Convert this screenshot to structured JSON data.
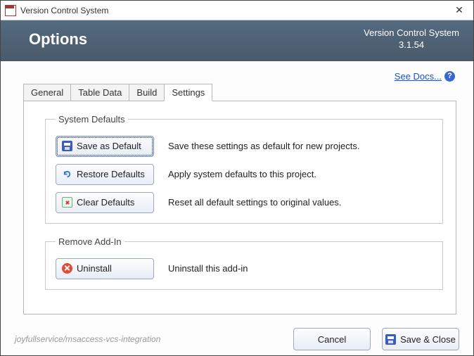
{
  "window": {
    "title": "Version Control System"
  },
  "header": {
    "title": "Options",
    "product": "Version Control System",
    "version": "3.1.54"
  },
  "links": {
    "see_docs": "See Docs..."
  },
  "tabs": {
    "general": "General",
    "table_data": "Table Data",
    "build": "Build",
    "settings": "Settings"
  },
  "groups": {
    "system_defaults": {
      "legend": "System Defaults",
      "save_default": {
        "label": "Save as Default",
        "desc": "Save these settings as default for new projects."
      },
      "restore_defaults": {
        "label": "Restore Defaults",
        "desc": "Apply system defaults to this project."
      },
      "clear_defaults": {
        "label": "Clear Defaults",
        "desc": "Reset all default settings to original values."
      }
    },
    "remove_addin": {
      "legend": "Remove Add-In",
      "uninstall": {
        "label": "Uninstall",
        "desc": "Uninstall this add-in"
      }
    }
  },
  "footer": {
    "repo": "joyfullservice/msaccess-vcs-integration",
    "cancel": "Cancel",
    "save_close": "Save & Close"
  }
}
